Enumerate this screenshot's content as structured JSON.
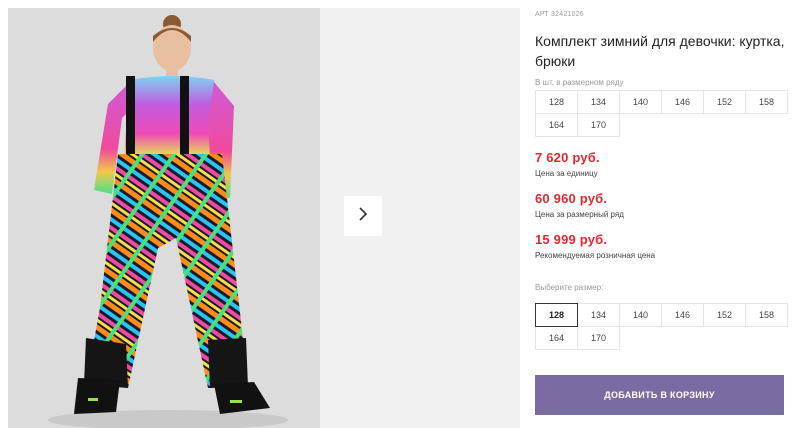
{
  "product": {
    "article": "АРТ 32421026",
    "title": "Комплект зимний для девочки: куртка, брюки"
  },
  "pack": {
    "label": "В шт. в размерном ряду",
    "sizes": [
      "128",
      "134",
      "140",
      "146",
      "152",
      "158",
      "164",
      "170"
    ]
  },
  "prices": {
    "unit_price": "7 620 руб.",
    "unit_label": "Цена за единицу",
    "row_price": "60 960 руб.",
    "row_label": "Цена за размерный ряд",
    "retail_price": "15 999 руб.",
    "retail_label": "Рекомендуемая розничная цена"
  },
  "size_select": {
    "label": "Выберите размер:",
    "sizes": [
      "128",
      "134",
      "140",
      "146",
      "152",
      "158",
      "164",
      "170"
    ],
    "selected": "128"
  },
  "actions": {
    "add_to_cart": "ДОБАВИТЬ В КОРЗИНУ"
  },
  "colors": {
    "price": "#e0282d",
    "button": "#7b6ba3"
  },
  "icons": {
    "next": "chevron-right-icon"
  }
}
